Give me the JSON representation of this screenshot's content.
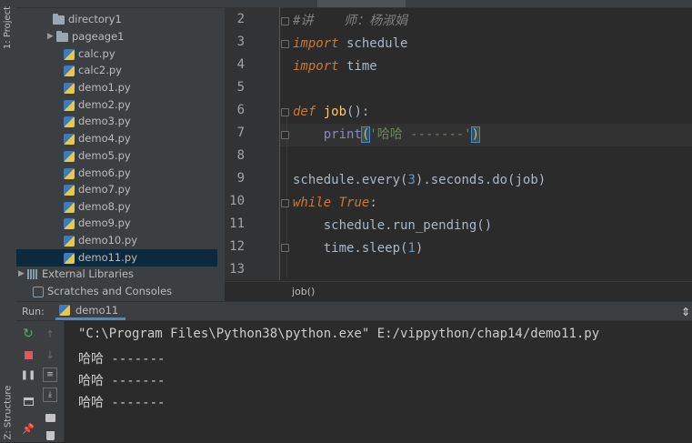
{
  "left_strip": {
    "project_tab": "1: Project",
    "structure_tab": "Z: Structure"
  },
  "project_tree": {
    "items": [
      {
        "label": "directory1",
        "kind": "folder",
        "expanded": false
      },
      {
        "label": "pageage1",
        "kind": "folder",
        "expanded": false
      },
      {
        "label": "calc.py",
        "kind": "python"
      },
      {
        "label": "calc2.py",
        "kind": "python"
      },
      {
        "label": "demo1.py",
        "kind": "python"
      },
      {
        "label": "demo2.py",
        "kind": "python"
      },
      {
        "label": "demo3.py",
        "kind": "python"
      },
      {
        "label": "demo4.py",
        "kind": "python"
      },
      {
        "label": "demo5.py",
        "kind": "python"
      },
      {
        "label": "demo6.py",
        "kind": "python"
      },
      {
        "label": "demo7.py",
        "kind": "python"
      },
      {
        "label": "demo8.py",
        "kind": "python"
      },
      {
        "label": "demo9.py",
        "kind": "python"
      },
      {
        "label": "demo10.py",
        "kind": "python"
      },
      {
        "label": "demo11.py",
        "kind": "python",
        "selected": true
      },
      {
        "label": "External Libraries",
        "kind": "library"
      },
      {
        "label": "Scratches and Consoles",
        "kind": "scratch"
      }
    ]
  },
  "editor": {
    "line_numbers": [
      "2",
      "3",
      "4",
      "5",
      "6",
      "7",
      "8",
      "9",
      "10",
      "11",
      "12",
      "13"
    ],
    "code": {
      "l2": {
        "comment": "#讲    师：杨淑娟"
      },
      "l3": {
        "kw": "import",
        "rest": " schedule"
      },
      "l4": {
        "kw": "import",
        "rest": " time"
      },
      "l6": {
        "kw": "def",
        "name": "job",
        "rest": "():"
      },
      "l7": {
        "indent": "    ",
        "call": "print",
        "open": "(",
        "string": "'哈哈 -------'",
        "close": ")"
      },
      "l9": {
        "a": "schedule.",
        "every": "every",
        "b": "(",
        "n": "3",
        "c": ").seconds.",
        "do": "do",
        "d": "(job)"
      },
      "l10": {
        "kw": "while",
        "true": "True",
        "colon": ":"
      },
      "l11": {
        "indent": "    ",
        "a": "schedule.",
        "m": "run_pending",
        "b": "()"
      },
      "l12": {
        "indent": "    ",
        "a": "time.",
        "m": "sleep",
        "b": "(",
        "n": "1",
        "c": ")"
      }
    },
    "breadcrumb": "job()"
  },
  "run_panel": {
    "label": "Run:",
    "tab": "demo11",
    "console_lines": [
      "\"C:\\Program Files\\Python38\\python.exe\" E:/vippython/chap14/demo11.py",
      "哈哈 -------",
      "哈哈 -------",
      "哈哈 -------"
    ]
  },
  "colors": {
    "keyword": "#cc7832",
    "function": "#ffc66d",
    "number": "#6897bb",
    "string": "#6a8759",
    "selection": "#0d293e"
  }
}
